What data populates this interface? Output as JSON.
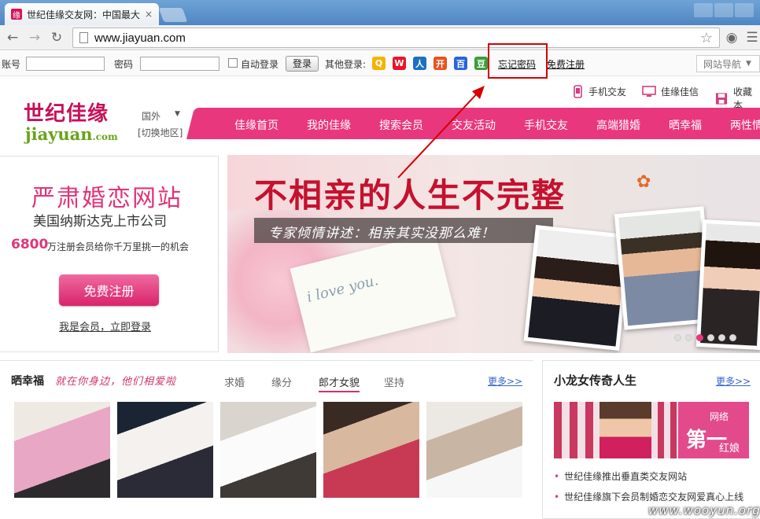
{
  "browser": {
    "tab_title": "世纪佳缘交友网：中国最大",
    "tab_close": "×",
    "url": "www.jiayuan.com",
    "icons": [
      "back-icon",
      "forward-icon",
      "reload-icon",
      "page-icon",
      "star-icon",
      "globe-icon",
      "wrench-icon"
    ]
  },
  "login_bar": {
    "account_label": "账号",
    "password_label": "密码",
    "auto_login_label": "自动登录",
    "login_button": "登录",
    "other_login_label": "其他登录:",
    "forgot_password": "忘记密码",
    "free_register": "免费注册",
    "site_nav": "网站导航",
    "social_icons": [
      {
        "name": "qq-icon",
        "color": "#f4b400",
        "glyph": "Q"
      },
      {
        "name": "weibo-icon",
        "color": "#e6162d",
        "glyph": "W"
      },
      {
        "name": "renren-icon",
        "color": "#1d6fc4",
        "glyph": "人"
      },
      {
        "name": "kaixin-icon",
        "color": "#e8541e",
        "glyph": "开"
      },
      {
        "name": "baidu-icon",
        "color": "#2a64d6",
        "glyph": "百"
      },
      {
        "name": "douban-icon",
        "color": "#3a9d3a",
        "glyph": "豆"
      }
    ]
  },
  "header": {
    "logo_cn": "世纪佳缘",
    "logo_en": "jiayuan",
    "logo_domain": ".com",
    "region": "国外",
    "region_switch": "[切换地区]",
    "top_links": [
      "手机交友",
      "佳缘佳信",
      "收藏本"
    ],
    "nav": [
      "佳缘首页",
      "我的佳缘",
      "搜索会员",
      "交友活动",
      "手机交友",
      "高端猎婚",
      "晒幸福",
      "两性情"
    ]
  },
  "promo": {
    "title": "严肃婚恋网站",
    "subtitle": "美国纳斯达克上市公司",
    "count": "6800",
    "desc": "万注册会员给你千万里挑一的机会",
    "register_button": "免费注册",
    "member_login": "我是会员，立即登录"
  },
  "banner": {
    "headline": "不相亲的人生不完整",
    "sub": "专家倾情讲述：相亲其实没那么难！",
    "card_text": "i love you.",
    "dots": 6,
    "active_dot": 2
  },
  "happiness": {
    "title": "晒幸福",
    "slogan": "就在你身边，他们相爱啦",
    "tabs": [
      "求婚",
      "缘分",
      "郎才女貌",
      "坚持"
    ],
    "active_tab": 2,
    "more": "更多>>"
  },
  "story": {
    "title": "小龙女传奇人生",
    "more": "更多>>",
    "banner_tag1": "网络",
    "banner_tag2": "第一",
    "banner_tag3": "红娘",
    "news": [
      "世纪佳缘推出垂直类交友网站",
      "世纪佳缘旗下会员制婚恋交友网爱真心上线"
    ]
  },
  "watermark": "www.wooyun.org",
  "colors": {
    "brand_pink": "#e9377d",
    "annotation_red": "#d40000",
    "headline_red": "#c5112e",
    "logo_green": "#6aa31a"
  }
}
